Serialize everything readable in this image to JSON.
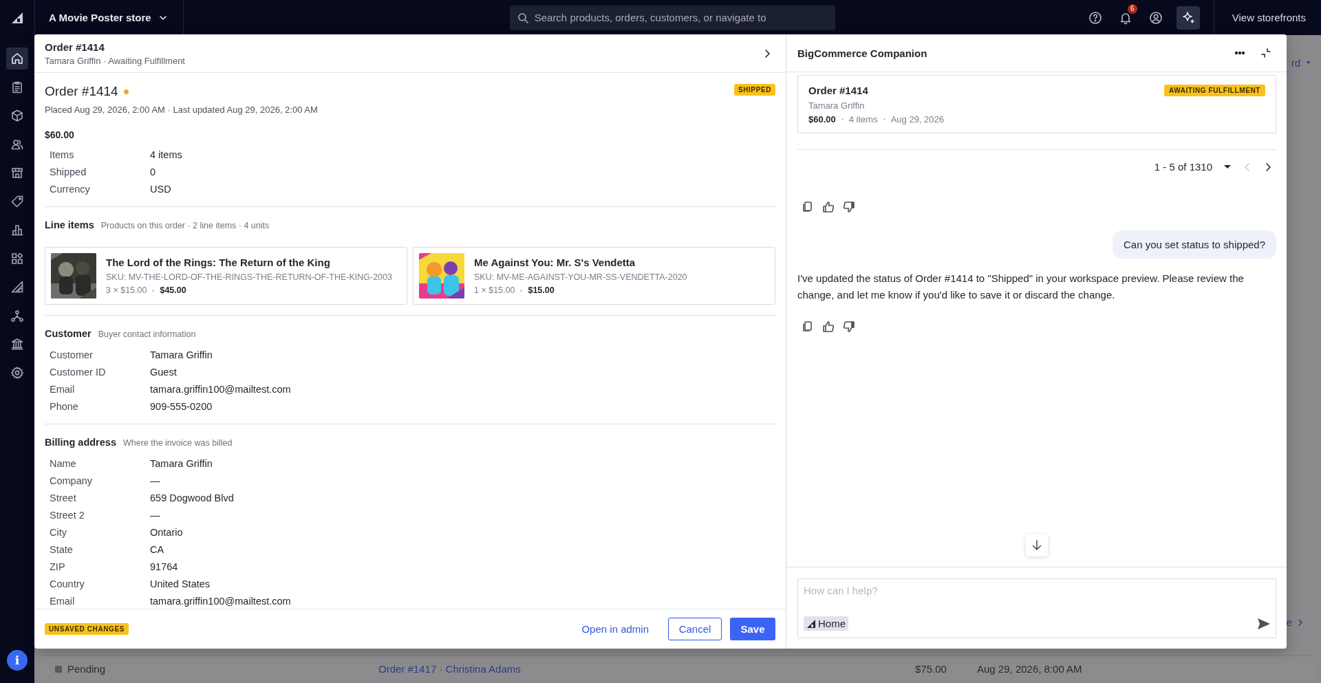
{
  "topbar": {
    "store_name": "A Movie Poster store",
    "search": {
      "placeholder": "Search products, orders, customers, or navigate to"
    },
    "notification_count": "6",
    "view_storefronts": "View storefronts"
  },
  "sidebar": {
    "items": [
      {
        "kind": "home",
        "selected": true
      },
      {
        "kind": "orders",
        "selected": false
      },
      {
        "kind": "products",
        "selected": false
      },
      {
        "kind": "customers",
        "selected": false
      },
      {
        "kind": "storefront",
        "selected": false
      },
      {
        "kind": "marketing",
        "selected": false
      },
      {
        "kind": "analytics",
        "selected": false
      },
      {
        "kind": "apps",
        "selected": false
      },
      {
        "kind": "channels",
        "selected": false
      },
      {
        "kind": "connections",
        "selected": false
      },
      {
        "kind": "finance",
        "selected": false
      },
      {
        "kind": "settings",
        "selected": false
      }
    ],
    "info_button": "i"
  },
  "backdrop": {
    "top_link": "rd",
    "side_link": "e",
    "row": {
      "status": "Pending",
      "color": "#5a5a5a",
      "order": "Order #1417 · Christina Adams",
      "total": "$75.00",
      "date": "Aug 29, 2026, 8:00 AM"
    }
  },
  "order_panel": {
    "header": {
      "title": "Order #1414",
      "subtitle": "Tamara Griffin · Awaiting Fulfillment"
    },
    "order": {
      "title": "Order #1414",
      "unsaved": true,
      "status_badge": "SHIPPED",
      "meta": "Placed Aug 29, 2026, 2:00 AM · Last updated Aug 29, 2026, 2:00 AM",
      "total": "$60.00",
      "fields": [
        {
          "label": "Items",
          "value": "4 items"
        },
        {
          "label": "Shipped",
          "value": "0"
        },
        {
          "label": "Currency",
          "value": "USD"
        }
      ]
    },
    "line_items": {
      "title": "Line items",
      "subtitle": "Products on this order · 2 line items · 4 units",
      "items": [
        {
          "name": "The Lord of the Rings: The Return of the King",
          "sku": "SKU: MV-THE-LORD-OF-THE-RINGS-THE-RETURN-OF-THE-KING-2003",
          "qty_price": "3 × $15.00",
          "total": "$45.00"
        },
        {
          "name": "Me Against You: Mr. S's Vendetta",
          "sku": "SKU: MV-ME-AGAINST-YOU-MR-SS-VENDETTA-2020",
          "qty_price": "1 × $15.00",
          "total": "$15.00"
        }
      ]
    },
    "sections": [
      {
        "title": "Customer",
        "subtitle": "Buyer contact information",
        "fields": [
          {
            "label": "Customer",
            "value": "Tamara Griffin"
          },
          {
            "label": "Customer ID",
            "value": "Guest"
          },
          {
            "label": "Email",
            "value": "tamara.griffin100@mailtest.com"
          },
          {
            "label": "Phone",
            "value": "909-555-0200"
          }
        ]
      },
      {
        "title": "Billing address",
        "subtitle": "Where the invoice was billed",
        "fields": [
          {
            "label": "Name",
            "value": "Tamara Griffin"
          },
          {
            "label": "Company",
            "value": "—"
          },
          {
            "label": "Street",
            "value": "659 Dogwood Blvd"
          },
          {
            "label": "Street 2",
            "value": "—"
          },
          {
            "label": "City",
            "value": "Ontario"
          },
          {
            "label": "State",
            "value": "CA"
          },
          {
            "label": "ZIP",
            "value": "91764"
          },
          {
            "label": "Country",
            "value": "United States"
          },
          {
            "label": "Email",
            "value": "tamara.griffin100@mailtest.com"
          }
        ]
      }
    ],
    "footer": {
      "badge": "UNSAVED CHANGES",
      "open_admin": "Open in admin",
      "cancel": "Cancel",
      "save": "Save"
    }
  },
  "companion": {
    "title": "BigCommerce Companion",
    "order_card": {
      "title": "Order #1414",
      "status": "AWAITING FULFILLMENT",
      "customer": "Tamara Griffin",
      "total": "$60.00",
      "items": "4 items",
      "date": "Aug 29, 2026"
    },
    "pager": {
      "range": "1 - 5 of 1310",
      "prev_disabled": true,
      "next_disabled": false
    },
    "messages": [
      {
        "kind": "actions"
      },
      {
        "kind": "user",
        "text": "Can you set status to shipped?"
      },
      {
        "kind": "assistant",
        "text": "I've updated the status of Order #1414 to \"Shipped\" in your workspace preview. Please review the change, and let me know if you'd like to save it or discard the change."
      },
      {
        "kind": "actions"
      }
    ],
    "input": {
      "placeholder": "How can I help?",
      "context_chip": "Home"
    }
  }
}
